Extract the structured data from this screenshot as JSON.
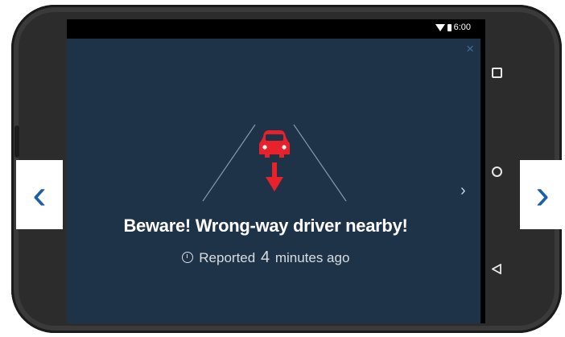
{
  "status_bar": {
    "time": "6:00"
  },
  "alert": {
    "title": "Beware! Wrong-way driver nearby!",
    "reported_prefix": "Reported",
    "reported_number": "4",
    "reported_suffix": "minutes ago",
    "accent_color": "#e8212a",
    "background_color": "#1f3348"
  },
  "icons": {
    "close": "close-icon",
    "car": "car-icon",
    "arrow": "arrow-down-icon",
    "clock": "clock-icon",
    "next_inner": "chevron-right-icon"
  },
  "carousel": {
    "prev_glyph": "‹",
    "next_glyph": "›",
    "inner_next_glyph": "›",
    "button_color": "#1d5fa5"
  },
  "navigation": {
    "close_glyph": "×"
  }
}
